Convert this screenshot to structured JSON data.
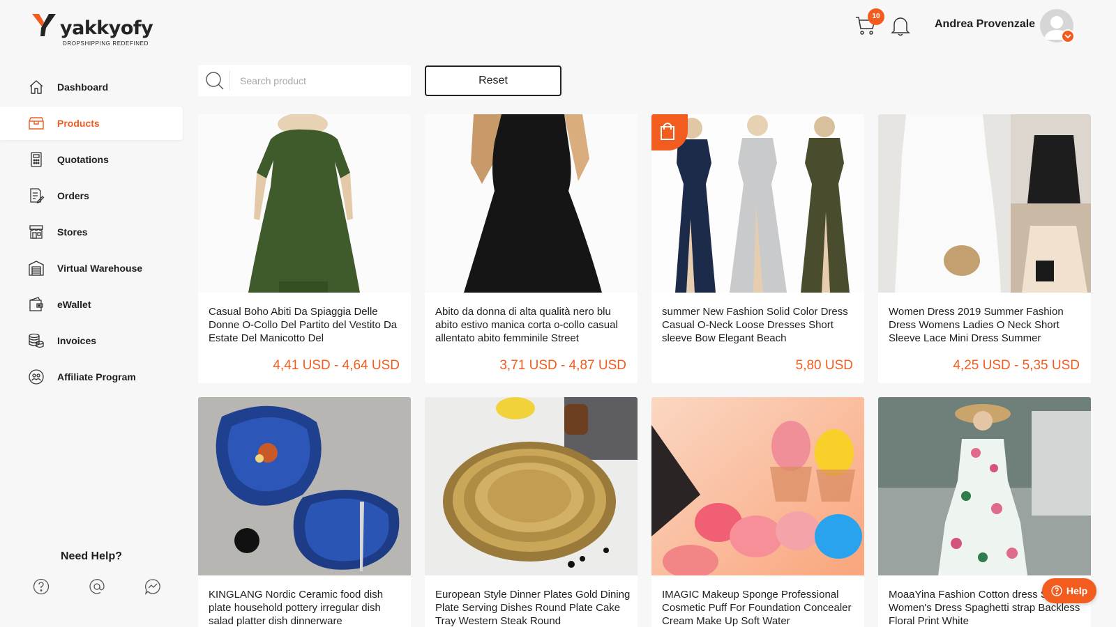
{
  "brand": {
    "name": "yakkyofy",
    "tagline": "DROPSHIPPING REDEFINED",
    "accent": "#f25c1f"
  },
  "sidebar": {
    "items": [
      {
        "label": "Dashboard",
        "icon": "home-icon",
        "active": false
      },
      {
        "label": "Products",
        "icon": "box-icon",
        "active": true
      },
      {
        "label": "Quotations",
        "icon": "calculator-icon",
        "active": false
      },
      {
        "label": "Orders",
        "icon": "orders-icon",
        "active": false
      },
      {
        "label": "Stores",
        "icon": "store-icon",
        "active": false
      },
      {
        "label": "Virtual Warehouse",
        "icon": "warehouse-icon",
        "active": false
      },
      {
        "label": "eWallet",
        "icon": "wallet-icon",
        "active": false
      },
      {
        "label": "Invoices",
        "icon": "coins-icon",
        "active": false
      },
      {
        "label": "Affiliate Program",
        "icon": "affiliate-icon",
        "active": false
      }
    ],
    "help": {
      "title": "Need Help?",
      "icons": [
        "question-icon",
        "email-icon",
        "chat-icon"
      ]
    }
  },
  "header": {
    "cart_count": "10",
    "user_name": "Andrea Provenzale"
  },
  "search": {
    "placeholder": "Search product",
    "value": ""
  },
  "reset_label": "Reset",
  "products": [
    {
      "title": "Casual Boho Abiti Da Spiaggia Delle Donne O-Collo Del Partito del Vestito Da Estate Del Manicotto Del",
      "price": "4,41 USD - 4,64 USD"
    },
    {
      "title": "Abito da donna di alta qualità nero blu abito estivo manica corta o-collo casual allentato abito femminile Street",
      "price": "3,71 USD - 4,87 USD"
    },
    {
      "title": "summer New Fashion Solid Color Dress Casual O-Neck Loose Dresses Short sleeve Bow Elegant Beach",
      "price": "5,80 USD"
    },
    {
      "title": "Women Dress 2019 Summer Fashion Dress Womens Ladies O Neck Short Sleeve Lace Mini Dress Summer",
      "price": "4,25 USD - 5,35 USD"
    },
    {
      "title": "KINGLANG Nordic Ceramic food dish plate household pottery irregular dish salad platter dish dinnerware",
      "price": ""
    },
    {
      "title": "European Style Dinner Plates Gold Dining Plate Serving Dishes Round Plate Cake Tray Western Steak Round",
      "price": ""
    },
    {
      "title": "IMAGIC Makeup Sponge Professional Cosmetic Puff For Foundation Concealer Cream Make Up Soft Water",
      "price": ""
    },
    {
      "title": "MoaaYina Fashion Cotton dress Summer Women's Dress Spaghetti strap Backless Floral Print White",
      "price": ""
    }
  ],
  "help_button": "Help"
}
